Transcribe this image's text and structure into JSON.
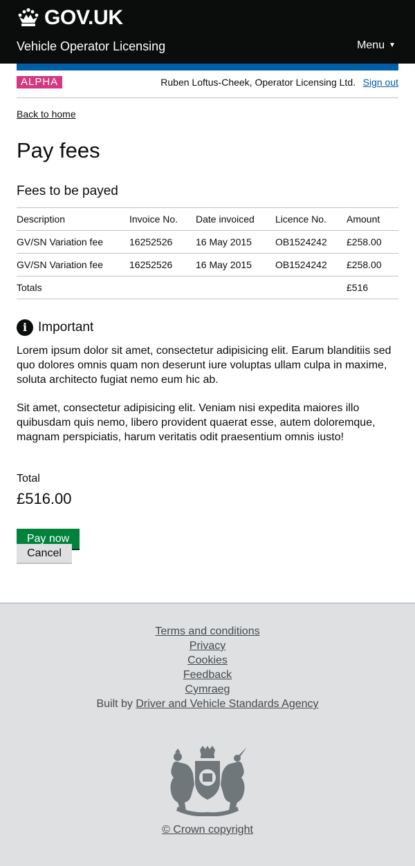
{
  "header": {
    "logo_text": "GOV.UK",
    "service_name": "Vehicle Operator Licensing",
    "menu_label": "Menu",
    "menu_caret": "▼"
  },
  "phase_banner": {
    "tag": "ALPHA",
    "user": "Ruben Loftus-Cheek, Operator Licensing Ltd.",
    "sign_out": "Sign out"
  },
  "back_link": "Back to home",
  "page_title": "Pay fees",
  "fees": {
    "title": "Fees to be payed",
    "headers": [
      "Description",
      "Invoice No.",
      "Date invoiced",
      "Licence No.",
      "Amount"
    ],
    "rows": [
      [
        "GV/SN Variation fee",
        "16252526",
        "16 May 2015",
        "OB1524242",
        "£258.00"
      ],
      [
        "GV/SN Variation fee",
        "16252526",
        "16 May 2015",
        "OB1524242",
        "£258.00"
      ]
    ],
    "totals_label": "Totals",
    "totals_amount": "£516"
  },
  "notice": {
    "icon_glyph": "i",
    "heading": "Important",
    "paragraphs": [
      "Lorem ipsum dolor sit amet, consectetur adipisicing elit. Earum blanditiis sed quo dolores omnis quam non deserunt iure voluptas ullam culpa in maxime, soluta architecto fugiat nemo eum hic ab.",
      "Sit amet, consectetur adipisicing elit. Veniam nisi expedita maiores illo quibusdam quis nemo, libero provident quaerat esse, autem doloremque, magnam perspiciatis, harum veritatis odit praesentium omnis iusto!"
    ]
  },
  "summary": {
    "total_label": "Total",
    "total_amount": "£516.00"
  },
  "actions": {
    "pay_label": "Pay now",
    "cancel_label": "Cancel"
  },
  "footer": {
    "links": [
      "Terms and conditions",
      "Privacy",
      "Cookies",
      "Feedback",
      "Cymraeg"
    ],
    "built_by_prefix": "Built by",
    "built_by_link": "Driver and Vehicle Standards Agency",
    "copyright": "© Crown copyright"
  },
  "colors": {
    "header_bg": "#0b0c0c",
    "accent_blue": "#005ea5",
    "alpha_tag": "#d53880",
    "pay_button": "#00823b",
    "footer_bg": "#dee0e2"
  },
  "icons": [
    "crown-icon",
    "menu-caret-icon",
    "info-icon",
    "royal-coat-of-arms-crest"
  ]
}
